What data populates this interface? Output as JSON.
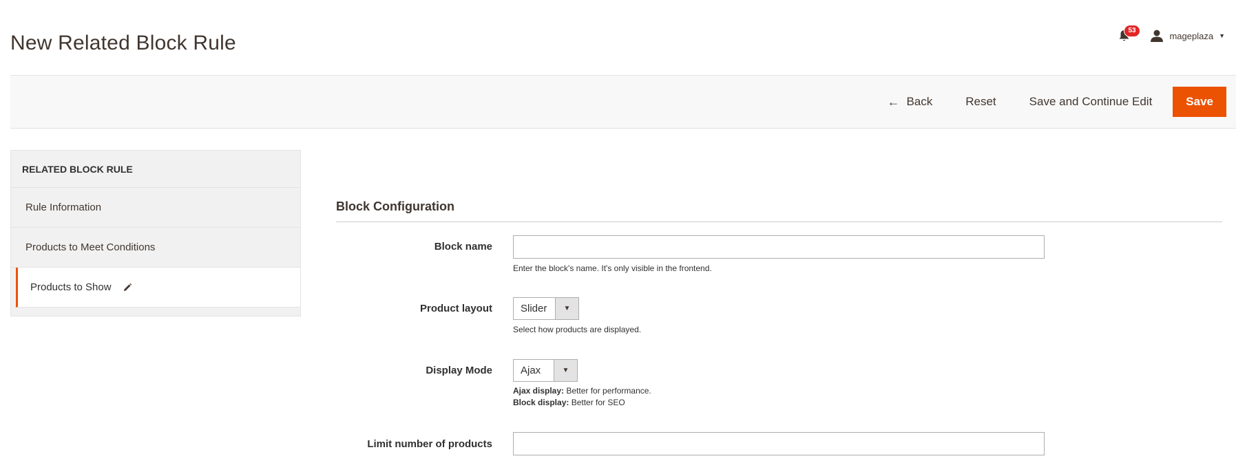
{
  "page": {
    "title": "New Related Block Rule"
  },
  "header": {
    "notifications_count": "53",
    "username": "mageplaza"
  },
  "toolbar": {
    "back_label": "Back",
    "reset_label": "Reset",
    "save_continue_label": "Save and Continue Edit",
    "save_label": "Save"
  },
  "sidebar": {
    "title": "RELATED BLOCK RULE",
    "items": [
      {
        "label": "Rule Information"
      },
      {
        "label": "Products to Meet Conditions"
      },
      {
        "label": "Products to Show"
      }
    ]
  },
  "form": {
    "section_title": "Block Configuration",
    "block_name": {
      "label": "Block name",
      "value": "",
      "note": "Enter the block's name. It's only visible in the frontend."
    },
    "product_layout": {
      "label": "Product layout",
      "value": "Slider",
      "note": "Select how products are displayed."
    },
    "display_mode": {
      "label": "Display Mode",
      "value": "Ajax",
      "note_ajax_bold": "Ajax display:",
      "note_ajax_text": " Better for performance.",
      "note_block_bold": "Block display:",
      "note_block_text": " Better for SEO"
    },
    "limit_products": {
      "label": "Limit number of products",
      "value": ""
    }
  },
  "colors": {
    "accent": "#eb5202",
    "badge": "#e22626"
  }
}
